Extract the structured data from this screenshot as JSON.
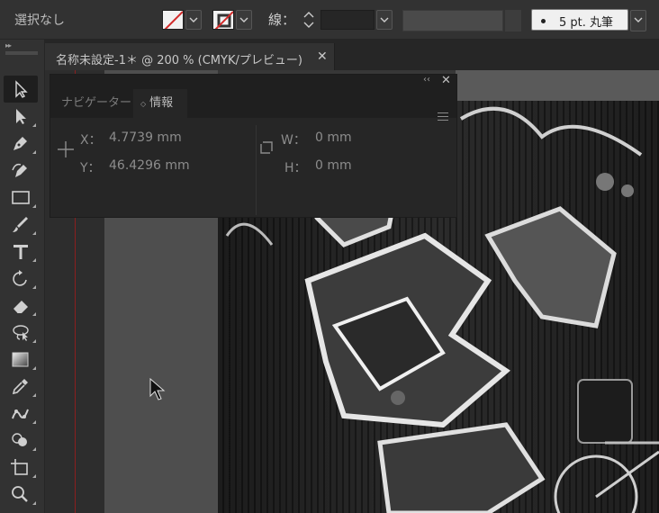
{
  "control_bar": {
    "selection_label": "選択なし",
    "stroke_label": "線：",
    "brush": {
      "bullet": "●",
      "label": "5 pt. 丸筆"
    }
  },
  "document_tab": {
    "title": "名称未設定-1＊ @ 200 % (CMYK/プレビュー)",
    "close_glyph": "✕"
  },
  "info_panel": {
    "tabs": [
      {
        "label": "ナビゲーター",
        "active": false
      },
      {
        "label": "情報",
        "active": true
      }
    ],
    "active_tab_arrows": "◇",
    "x_label": "X：",
    "x_value": "4.7739 mm",
    "y_label": "Y：",
    "y_value": "46.4296 mm",
    "w_label": "W：",
    "w_value": "0 mm",
    "h_label": "H：",
    "h_value": "0 mm",
    "collapse_glyph": "‹‹",
    "close_glyph": "✕"
  },
  "toolbar": {
    "grip_glyph": "▸▸",
    "tools": [
      {
        "name": "selection-tool",
        "active": true
      },
      {
        "name": "direct-selection-tool",
        "active": false
      },
      {
        "name": "pen-tool",
        "active": false
      },
      {
        "name": "curvature-tool",
        "active": false
      },
      {
        "name": "rectangle-tool",
        "active": false
      },
      {
        "name": "paintbrush-tool",
        "active": false
      },
      {
        "name": "type-tool",
        "active": false
      },
      {
        "name": "rotate-tool",
        "active": false
      },
      {
        "name": "eraser-tool",
        "active": false
      },
      {
        "name": "lasso-tool",
        "active": false
      },
      {
        "name": "gradient-tool",
        "active": false
      },
      {
        "name": "eyedropper-tool",
        "active": false
      },
      {
        "name": "puppet-warp-tool",
        "active": false
      },
      {
        "name": "shape-builder-tool",
        "active": false
      },
      {
        "name": "artboard-tool",
        "active": false
      },
      {
        "name": "zoom-tool",
        "active": false
      }
    ]
  },
  "colors": {
    "ui_background": "#323232",
    "panel_background": "#262626",
    "no_fill_slash": "#d22b2b"
  }
}
